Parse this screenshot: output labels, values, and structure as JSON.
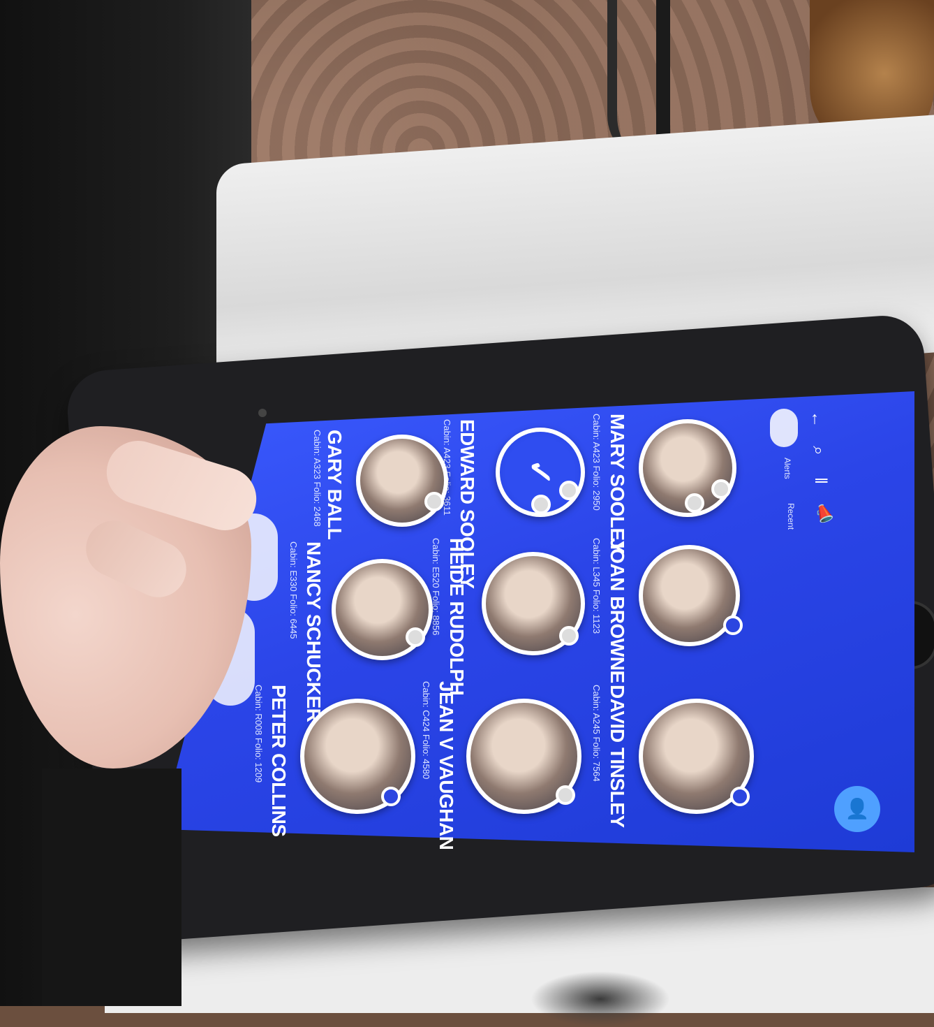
{
  "top_bar": {
    "icons": [
      "back-arrow-icon",
      "search-icon",
      "pause-icon",
      "megaphone-icon"
    ],
    "button_label": "",
    "menu_labels": [
      "Alerts",
      "Recent"
    ]
  },
  "residents": [
    {
      "name": "MARY SOOLEY",
      "detail": "Cabin: A423 Folio: 2950"
    },
    {
      "name": "JOAN BROWNE",
      "detail": "Cabin: L345 Folio: 1123"
    },
    {
      "name": "DAVID TINSLEY",
      "detail": "Cabin: A245 Folio: 7564"
    },
    {
      "name": "EDWARD SOOLEY",
      "detail": "Cabin: A423 Folio: 3611"
    },
    {
      "name": "HEIDE RUDOLPH",
      "detail": "Cabin: E520 Folio: 8856"
    },
    {
      "name": "JEAN V VAUGHAN",
      "detail": "Cabin: C424 Folio: 4580"
    },
    {
      "name": "GARY BALL",
      "detail": "Cabin: A323 Folio: 2468"
    },
    {
      "name": "NANCY SCHUCKER",
      "detail": "Cabin: E330 Folio: 6445"
    },
    {
      "name": "PETER COLLINS",
      "detail": "Cabin: R008 Folio: 1209"
    }
  ],
  "bottom_buttons": [
    "",
    ""
  ],
  "selected_check": "✓",
  "fab_icon": "person-icon",
  "colors": {
    "screen_blue": "#2b45e8",
    "accent": "#4fa0ff",
    "white": "#ffffff"
  }
}
